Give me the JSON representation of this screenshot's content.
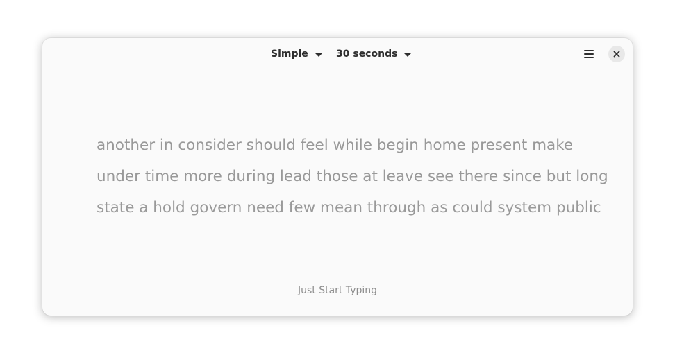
{
  "header": {
    "mode_label": "Simple",
    "duration_label": "30 seconds"
  },
  "icons": {
    "menu": "hamburger-menu-icon",
    "close": "close-icon",
    "dropdown": "chevron-down-icon"
  },
  "typing_text": {
    "lines": [
      "another in consider should feel while begin home present make",
      "under time more during lead those at leave see there since but long",
      "state a hold govern need few mean through as could system public"
    ]
  },
  "footer": {
    "hint": "Just Start Typing"
  },
  "colors": {
    "window_bg": "#fafafa",
    "text_pending": "#999999",
    "hint": "#8c8c8c",
    "header_text": "#2e2e2e"
  }
}
